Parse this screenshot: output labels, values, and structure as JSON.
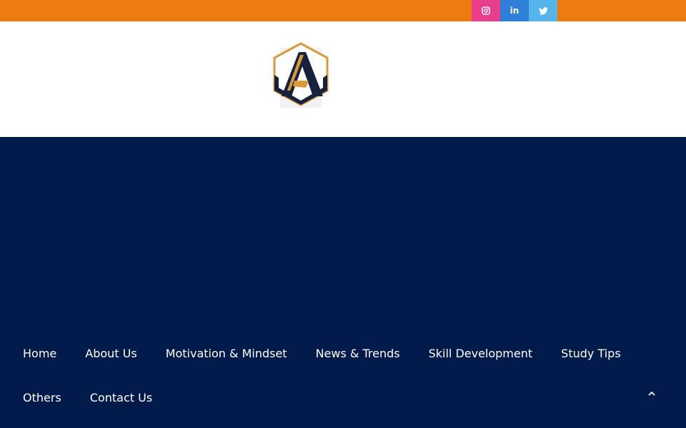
{
  "social": [
    {
      "name": "instagram",
      "icon": "instagram-icon",
      "color": "#e83e8c"
    },
    {
      "name": "linkedin",
      "icon": "linkedin-icon",
      "color": "#2f7ed8",
      "glyph": "in"
    },
    {
      "name": "twitter",
      "icon": "twitter-icon",
      "color": "#55b4ea"
    }
  ],
  "colors": {
    "topbar": "#ec7a0d",
    "header_bg": "#ffffff",
    "main_bg": "#001a4a",
    "logo_gold": "#d99a3a",
    "logo_navy": "#16213e"
  },
  "logo": {
    "icon": "logo-hexagon-a-icon"
  },
  "nav": {
    "items": [
      {
        "label": "Home"
      },
      {
        "label": "About Us"
      },
      {
        "label": "Motivation & Mindset"
      },
      {
        "label": "News & Trends"
      },
      {
        "label": "Skill Development"
      },
      {
        "label": "Study Tips"
      },
      {
        "label": "Others"
      },
      {
        "label": "Contact Us"
      }
    ]
  },
  "back_to_top": {
    "icon": "chevron-up-icon"
  }
}
